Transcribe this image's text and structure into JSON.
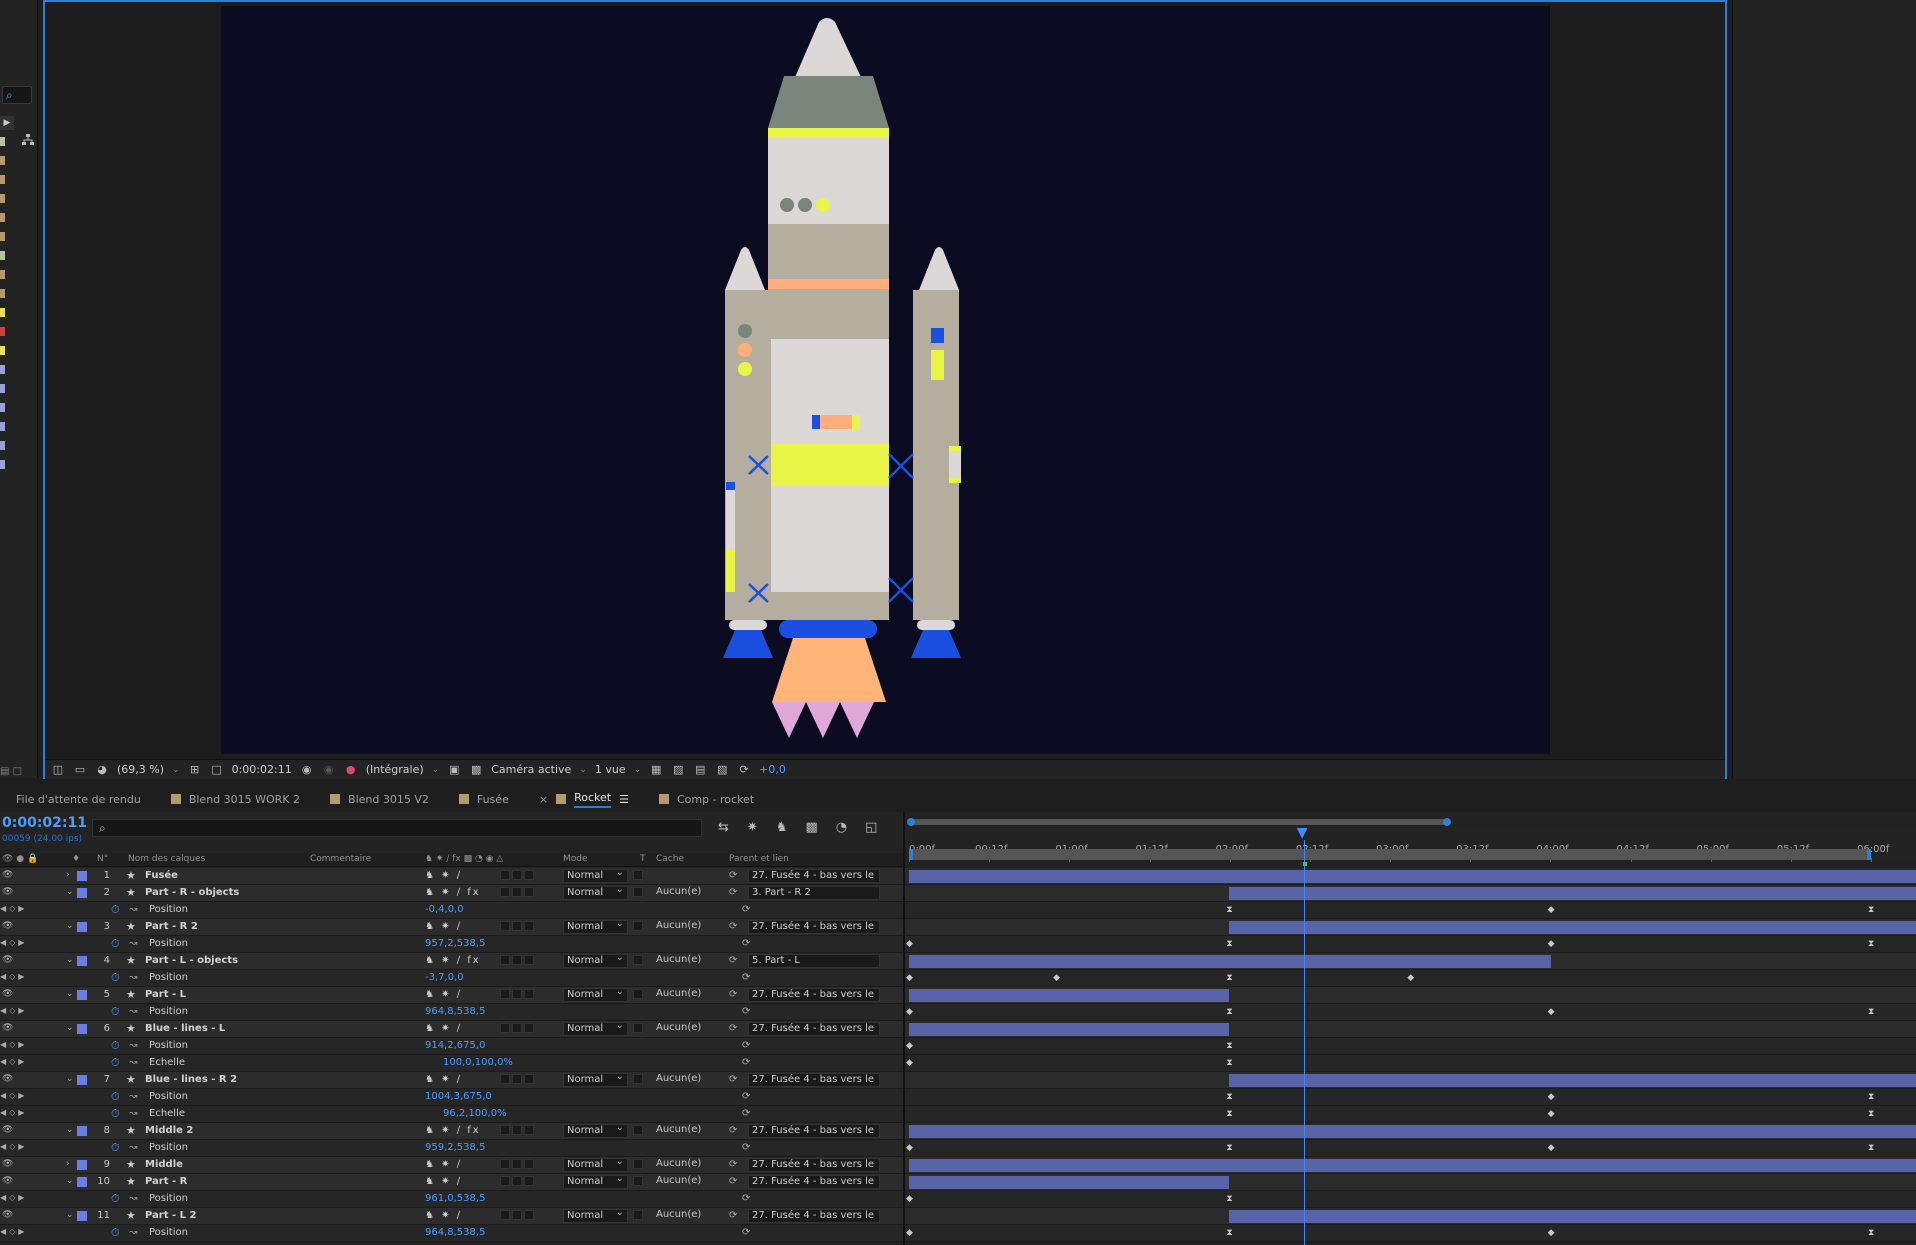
{
  "viewer": {
    "zoom": "(69,3 %)",
    "timecode": "0:00:02:11",
    "resolution": "(Intégrale)",
    "camera": "Caméra active",
    "views": "1 vue",
    "exposure": "+0,0"
  },
  "tabs": [
    {
      "label": "File d'attente de rendu"
    },
    {
      "label": "Blend 3015 WORK 2"
    },
    {
      "label": "Blend 3015 V2"
    },
    {
      "label": "Fusée"
    },
    {
      "label": "Rocket"
    },
    {
      "label": "Comp - rocket"
    }
  ],
  "timeline": {
    "current_time": "0:00:02:11",
    "fps": "00059 (24.00 ips)",
    "search_placeholder": "",
    "columns": {
      "num": "N°",
      "name": "Nom des calques",
      "comment": "Commentaire",
      "mode": "Mode",
      "t": "T",
      "cache": "Cache",
      "parent": "Parent et lien"
    },
    "ruler": [
      "0:00f",
      "00:12f",
      "01:00f",
      "01:12f",
      "02:00f",
      "02:12f",
      "03:00f",
      "03:12f",
      "04:00f",
      "04:12f",
      "05:00f",
      "05:12f",
      "06:00f"
    ],
    "current_time_fraction": 0.4104
  },
  "rows": [
    {
      "type": "layer",
      "num": "1",
      "name": "Fusée",
      "mode": "Normal",
      "cache": "",
      "parent": "27. Fusée 4 - bas vers le",
      "fx": false,
      "expanded": false,
      "bar": [
        0.0,
        1.0
      ]
    },
    {
      "type": "layer",
      "num": "2",
      "name": "Part - R - objects",
      "mode": "Normal",
      "cache": "Aucun(e)",
      "parent": "3. Part - R 2",
      "fx": true,
      "expanded": true,
      "bar": [
        0.333,
        1.0
      ]
    },
    {
      "type": "prop",
      "name": "Position",
      "value": "-0,4,0,0",
      "keys": [
        0.333,
        0.667,
        1.0
      ]
    },
    {
      "type": "layer",
      "num": "3",
      "name": "Part - R 2",
      "mode": "Normal",
      "cache": "Aucun(e)",
      "parent": "27. Fusée 4 - bas vers le",
      "fx": false,
      "expanded": true,
      "bar": [
        0.333,
        1.0
      ]
    },
    {
      "type": "prop",
      "name": "Position",
      "value": "957,2,538,5",
      "keys": [
        0.0,
        0.333,
        0.667,
        1.0
      ]
    },
    {
      "type": "layer",
      "num": "4",
      "name": "Part - L - objects",
      "mode": "Normal",
      "cache": "Aucun(e)",
      "parent": "5. Part - L",
      "fx": true,
      "expanded": true,
      "bar": [
        0.0,
        0.667
      ]
    },
    {
      "type": "prop",
      "name": "Position",
      "value": "-3,7,0,0",
      "keys": [
        0.0,
        0.153,
        0.333,
        0.521
      ]
    },
    {
      "type": "layer",
      "num": "5",
      "name": "Part - L",
      "mode": "Normal",
      "cache": "Aucun(e)",
      "parent": "27. Fusée 4 - bas vers le",
      "fx": false,
      "expanded": true,
      "bar": [
        0.0,
        0.333
      ]
    },
    {
      "type": "prop",
      "name": "Position",
      "value": "964,8,538,5",
      "keys": [
        0.0,
        0.333,
        0.667,
        1.0
      ]
    },
    {
      "type": "layer",
      "num": "6",
      "name": "Blue - lines - L",
      "mode": "Normal",
      "cache": "Aucun(e)",
      "parent": "27. Fusée 4 - bas vers le",
      "fx": false,
      "expanded": true,
      "bar": [
        0.0,
        0.333
      ]
    },
    {
      "type": "prop",
      "name": "Position",
      "value": "914,2,675,0",
      "keys": [
        0.0,
        0.333
      ]
    },
    {
      "type": "prop",
      "name": "Echelle",
      "value": "100,0,100,0%",
      "shift": true,
      "keys": [
        0.0,
        0.333
      ]
    },
    {
      "type": "layer",
      "num": "7",
      "name": "Blue - lines - R 2",
      "mode": "Normal",
      "cache": "Aucun(e)",
      "parent": "27. Fusée 4 - bas vers le",
      "fx": false,
      "expanded": true,
      "bar": [
        0.333,
        1.0
      ]
    },
    {
      "type": "prop",
      "name": "Position",
      "value": "1004,3,675,0",
      "keys": [
        0.333,
        0.667,
        1.0
      ]
    },
    {
      "type": "prop",
      "name": "Echelle",
      "value": "96,2,100,0%",
      "shift": true,
      "keys": [
        0.333,
        0.667,
        1.0
      ]
    },
    {
      "type": "layer",
      "num": "8",
      "name": "Middle 2",
      "mode": "Normal",
      "cache": "Aucun(e)",
      "parent": "27. Fusée 4 - bas vers le",
      "fx": true,
      "expanded": true,
      "bar": [
        0.0,
        1.0
      ]
    },
    {
      "type": "prop",
      "name": "Position",
      "value": "959,2,538,5",
      "keys": [
        0.0,
        0.333,
        0.667,
        1.0
      ]
    },
    {
      "type": "layer",
      "num": "9",
      "name": "Middle",
      "mode": "Normal",
      "cache": "Aucun(e)",
      "parent": "27. Fusée 4 - bas vers le",
      "fx": false,
      "expanded": false,
      "bar": [
        0.0,
        1.0
      ]
    },
    {
      "type": "layer",
      "num": "10",
      "name": "Part - R",
      "mode": "Normal",
      "cache": "Aucun(e)",
      "parent": "27. Fusée 4 - bas vers le",
      "fx": false,
      "expanded": true,
      "bar": [
        0.0,
        0.333
      ]
    },
    {
      "type": "prop",
      "name": "Position",
      "value": "961,0,538,5",
      "keys": [
        0.0,
        0.333
      ]
    },
    {
      "type": "layer",
      "num": "11",
      "name": "Part - L 2",
      "mode": "Normal",
      "cache": "Aucun(e)",
      "parent": "27. Fusée 4 - bas vers le",
      "fx": false,
      "expanded": true,
      "bar": [
        0.333,
        1.0
      ]
    },
    {
      "type": "prop",
      "name": "Position",
      "value": "964,8,538,5",
      "keys": [
        0.0,
        0.333,
        0.667,
        1.0
      ]
    }
  ],
  "colors": {
    "accent": "#2d7fd6",
    "timecode": "#4f9cff",
    "layer_bar": "#5964a8",
    "label": "#6a7fe0",
    "comp_bg": "#0b0b22"
  }
}
